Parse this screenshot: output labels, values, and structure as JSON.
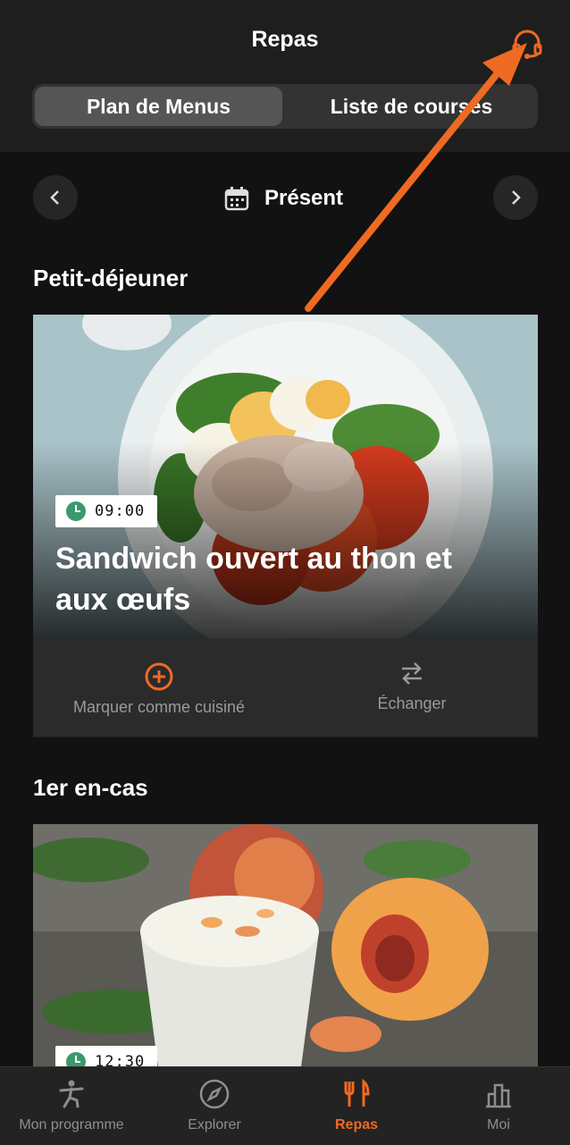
{
  "header": {
    "title": "Repas"
  },
  "segment": {
    "plan_label": "Plan de Menus",
    "shopping_label": "Liste de courses"
  },
  "date_nav": {
    "label": "Présent"
  },
  "sections": [
    {
      "title": "Petit-déjeuner",
      "time": "09:00",
      "meal": "Sandwich ouvert au thon et aux œufs"
    },
    {
      "title": "1er en-cas",
      "time": "12:30"
    }
  ],
  "actions": {
    "mark_cooked": "Marquer comme cuisiné",
    "swap": "Échanger"
  },
  "tabs": [
    {
      "label": "Mon programme",
      "icon": "workout-icon"
    },
    {
      "label": "Explorer",
      "icon": "compass-icon"
    },
    {
      "label": "Repas",
      "icon": "fork-knife-icon"
    },
    {
      "label": "Moi",
      "icon": "chart-icon"
    }
  ],
  "colors": {
    "accent": "#ef6a22",
    "background": "#121212",
    "header": "#1e1e1e",
    "clock": "#3a9a6c"
  }
}
